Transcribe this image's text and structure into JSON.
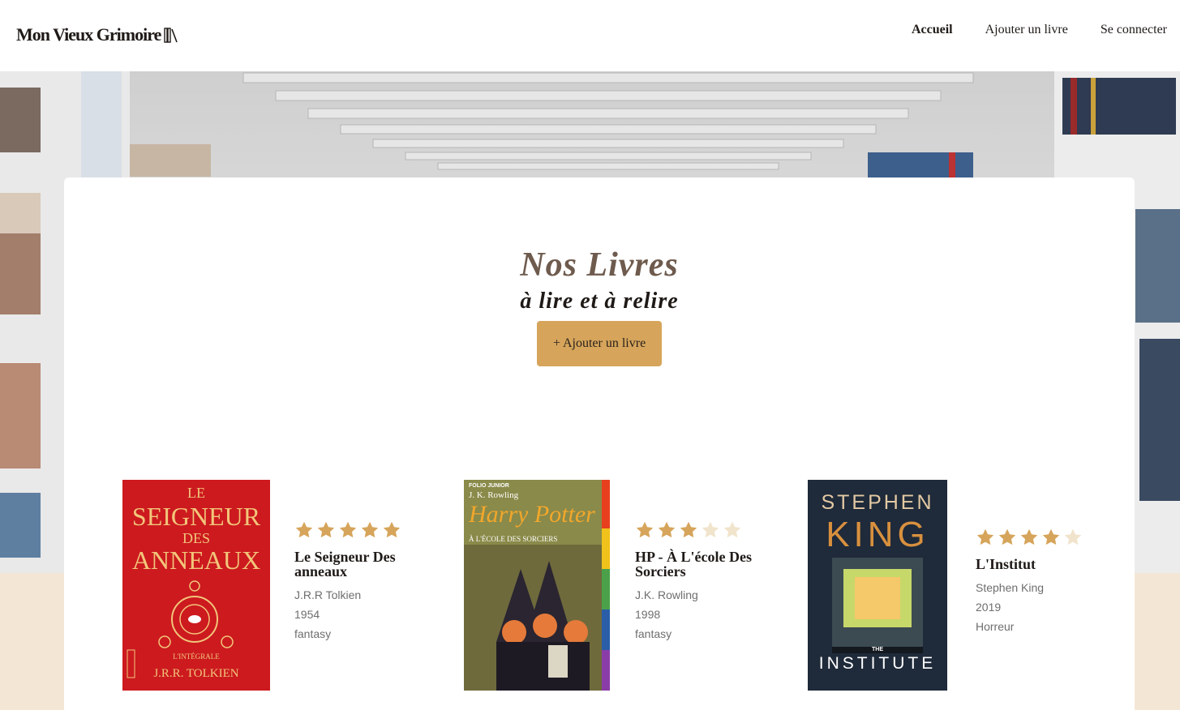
{
  "header": {
    "logo_text": "Mon Vieux Grimoire",
    "logo_icon": "books-icon",
    "nav": [
      {
        "label": "Accueil",
        "active": true
      },
      {
        "label": "Ajouter un livre",
        "active": false
      },
      {
        "label": "Se connecter",
        "active": false
      }
    ]
  },
  "main": {
    "title": "Nos Livres",
    "subtitle": "à lire et à relire",
    "add_button": "+ Ajouter un livre"
  },
  "books": [
    {
      "title": "Le Seigneur Des anneaux",
      "author": "J.R.R Tolkien",
      "year": "1954",
      "genre": "fantasy",
      "rating": 5,
      "cover": {
        "line1": "LE",
        "line2": "SEIGNEUR",
        "line3": "DES",
        "line4": "ANNEAUX",
        "line5": "L'INTÉGRALE",
        "line6": "J.R.R. TOLKIEN"
      }
    },
    {
      "title": "HP - À L'école Des Sorciers",
      "author": "J.K. Rowling",
      "year": "1998",
      "genre": "fantasy",
      "rating": 3,
      "cover": {
        "line1": "FOLIO JUNIOR",
        "line2": "J. K. Rowling",
        "line3": "Harry Potter",
        "line4": "À L'ÉCOLE DES SORCIERS"
      }
    },
    {
      "title": "L'Institut",
      "author": "Stephen King",
      "year": "2019",
      "genre": "Horreur",
      "rating": 4,
      "cover": {
        "line1": "STEPHEN",
        "line2": "KING",
        "line3": "THE",
        "line4": "INSTITUTE"
      }
    }
  ],
  "colors": {
    "accent": "#d6a55b",
    "star_filled": "#d6a55b",
    "star_empty": "#f1e4cc",
    "title": "#6e5b4e"
  }
}
